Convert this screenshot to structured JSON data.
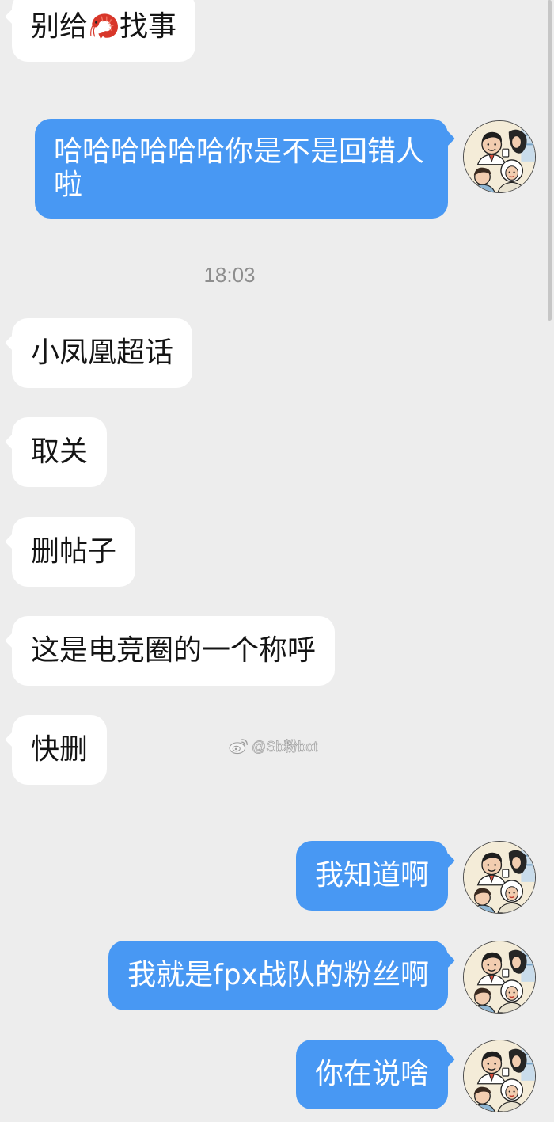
{
  "theme": {
    "page_background": "#ededed",
    "incoming_bubble_color": "#ffffff",
    "incoming_text_color": "#141414",
    "outgoing_bubble_color": "#4898f3",
    "outgoing_text_color": "#ffffff",
    "timestamp_color": "#8e8e8e"
  },
  "chat": {
    "messages": [
      {
        "incoming": {
          "text_before_emoji": "别给",
          "emoji_icon": "shrimp-emoji-icon",
          "text_after_emoji": "找事"
        }
      },
      {
        "outgoing": {
          "text": "哈哈哈哈哈哈你是不是回错人啦",
          "avatar_icon": "avatar"
        }
      },
      {
        "timestamp": "18:03"
      },
      {
        "incoming": {
          "text": "小凤凰超话"
        }
      },
      {
        "incoming": {
          "text": "取关"
        }
      },
      {
        "incoming": {
          "text": "删帖子"
        }
      },
      {
        "incoming": {
          "text": "这是电竞圈的一个称呼"
        }
      },
      {
        "incoming": {
          "text": "快删"
        }
      },
      {
        "outgoing": {
          "text": "我知道啊",
          "avatar_icon": "avatar"
        }
      },
      {
        "outgoing": {
          "text": "我就是fpx战队的粉丝啊",
          "avatar_icon": "avatar"
        }
      },
      {
        "outgoing": {
          "text": "你在说啥",
          "avatar_icon": "avatar"
        }
      }
    ]
  },
  "watermark": {
    "icon": "weibo-logo-icon",
    "text": "@Sb粉bot"
  }
}
